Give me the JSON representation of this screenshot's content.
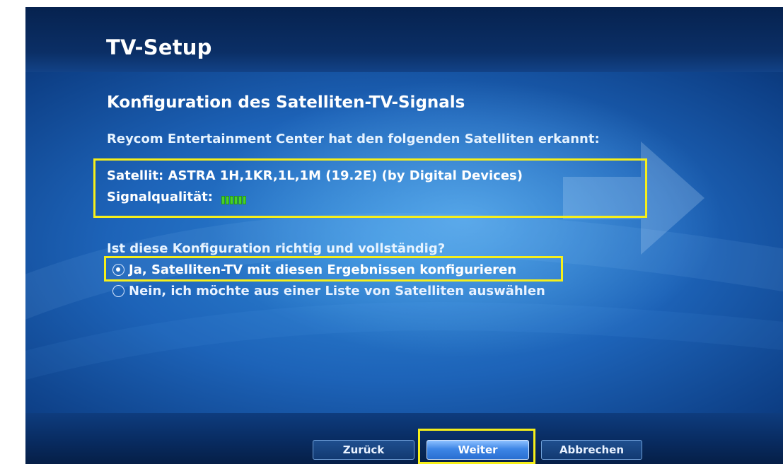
{
  "header": {
    "title": "TV-Setup"
  },
  "main": {
    "heading": "Konfiguration des Satelliten-TV-Signals",
    "detected_text": "Reycom Entertainment Center hat den folgenden Satelliten erkannt:",
    "satellite": {
      "label": "Satellit:",
      "value": "ASTRA 1H,1KR,1L,1M (19.2E) (by Digital Devices)"
    },
    "signal": {
      "label": "Signalqualität:",
      "level_bars": 6,
      "level_fraction": 1.0,
      "color": "#47d12a"
    },
    "question": "Ist diese Konfiguration richtig und vollständig?",
    "options": [
      {
        "label": "Ja, Satelliten-TV mit diesen Ergebnissen konfigurieren",
        "selected": true
      },
      {
        "label": "Nein, ich möchte aus einer Liste von Satelliten auswählen",
        "selected": false
      }
    ]
  },
  "footer": {
    "back_label": "Zurück",
    "next_label": "Weiter",
    "cancel_label": "Abbrechen"
  },
  "colors": {
    "highlight": "#f6ef1a",
    "background": "#1d63b8",
    "header_band": "#0b2f66"
  }
}
